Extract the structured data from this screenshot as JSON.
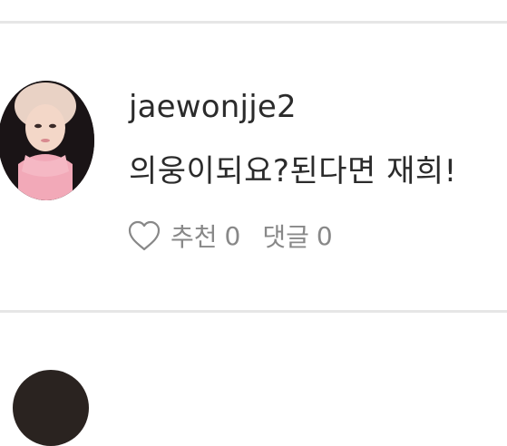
{
  "comment": {
    "username": "jaewonjje2",
    "text": "의웅이되요?된다면 재희!",
    "like_label": "추천",
    "like_count": "0",
    "reply_label": "댓글",
    "reply_count": "0"
  },
  "icons": {
    "like": "heart-outline-icon"
  },
  "colors": {
    "divider": "#e6e6e6",
    "text": "#2b2b2b",
    "muted": "#888888",
    "avatar_sweater": "#f2a9b8"
  }
}
